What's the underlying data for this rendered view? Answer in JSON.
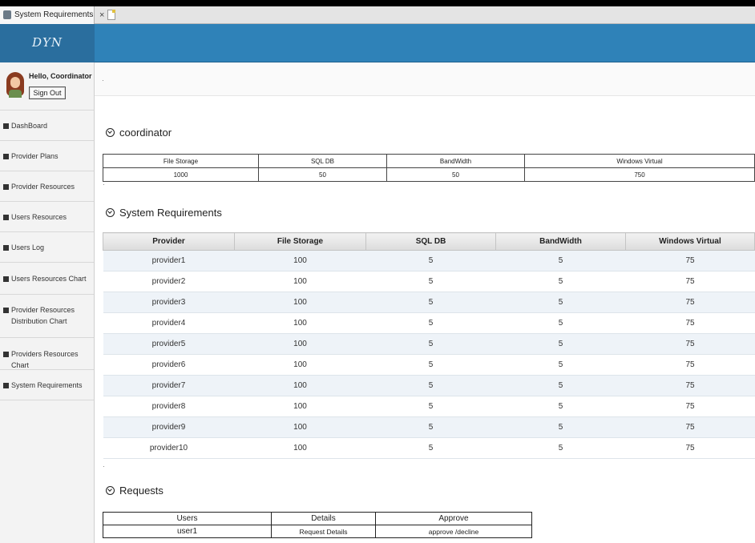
{
  "browser": {
    "tab_title": "System Requirements",
    "tab_close": "×"
  },
  "header": {
    "brand": "DYN"
  },
  "sidebar": {
    "greeting": "Hello, Coordinator",
    "sign_out": "Sign Out",
    "items": [
      {
        "label": "DashBoard",
        "icon": "home-icon"
      },
      {
        "label": "Provider Plans",
        "icon": "grid-icon"
      },
      {
        "label": "Provider Resources",
        "icon": "edit-icon"
      },
      {
        "label": "Users Resources",
        "icon": "edit-icon"
      },
      {
        "label": "Users Log",
        "icon": "table-icon"
      },
      {
        "label": "Users Resources Chart",
        "icon": "table-icon"
      },
      {
        "label": "Provider Resources Distribution Chart",
        "icon": "table-icon"
      },
      {
        "label": "Providers Resources Chart",
        "icon": "table-icon"
      },
      {
        "label": "System Requirements",
        "icon": "table-icon"
      }
    ]
  },
  "coordinator": {
    "title": "coordinator",
    "headers": [
      "File Storage",
      "SQL DB",
      "BandWidth",
      "Windows Virtual"
    ],
    "values": [
      "1000",
      "50",
      "50",
      "750"
    ]
  },
  "requirements": {
    "title": "System Requirements",
    "headers": [
      "Provider",
      "File Storage",
      "SQL DB",
      "BandWidth",
      "Windows Virtual"
    ],
    "rows": [
      [
        "provider1",
        "100",
        "5",
        "5",
        "75"
      ],
      [
        "provider2",
        "100",
        "5",
        "5",
        "75"
      ],
      [
        "provider3",
        "100",
        "5",
        "5",
        "75"
      ],
      [
        "provider4",
        "100",
        "5",
        "5",
        "75"
      ],
      [
        "provider5",
        "100",
        "5",
        "5",
        "75"
      ],
      [
        "provider6",
        "100",
        "5",
        "5",
        "75"
      ],
      [
        "provider7",
        "100",
        "5",
        "5",
        "75"
      ],
      [
        "provider8",
        "100",
        "5",
        "5",
        "75"
      ],
      [
        "provider9",
        "100",
        "5",
        "5",
        "75"
      ],
      [
        "provider10",
        "100",
        "5",
        "5",
        "75"
      ]
    ]
  },
  "requests": {
    "title": "Requests",
    "headers": [
      "Users",
      "Details",
      "Approve"
    ],
    "rows": [
      [
        "user1",
        "Request Details",
        "approve /decline"
      ]
    ]
  }
}
